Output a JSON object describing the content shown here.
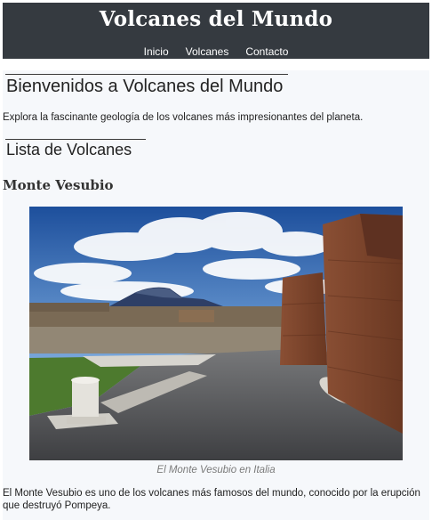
{
  "header": {
    "site_title": "Volcanes del Mundo",
    "nav": [
      "Inicio",
      "Volcanes",
      "Contacto"
    ]
  },
  "main": {
    "welcome_heading": "Bienvenidos a Volcanes del Mundo",
    "intro": "Explora la fascinante geología de los volcanes más impresionantes del planeta.",
    "list_heading": "Lista de Volcanes",
    "volcano": {
      "name": "Monte Vesubio",
      "caption": "El Monte Vesubio en Italia",
      "description": "El Monte Vesubio es uno de los volcanes más famosos del mundo, conocido por la erupción que destruyó Pompeya."
    }
  },
  "colors": {
    "header_bg": "#353a40",
    "page_bg": "#f6f8fb",
    "caption": "#7a7a7a"
  }
}
